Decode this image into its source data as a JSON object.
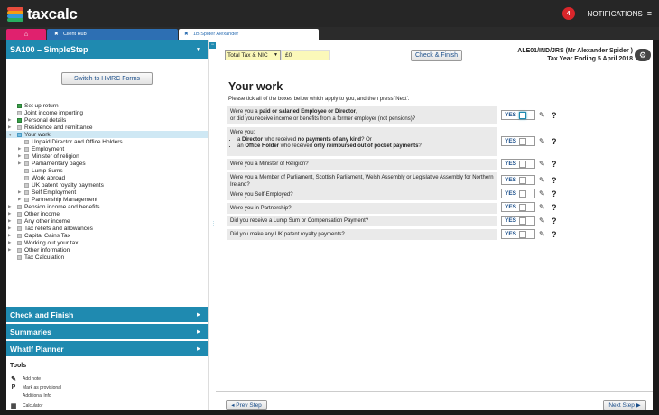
{
  "app": {
    "logo_text": "taxcalc",
    "logo_stripes": [
      "#e84c3d",
      "#f39c12",
      "#3498db",
      "#27ae60"
    ]
  },
  "notifications": {
    "count": "4",
    "label": "NOTIFICATIONS",
    "menu_icon": "≡"
  },
  "tabs": {
    "home_icon": "⌂",
    "client_hub": {
      "close": "✖",
      "label": "Client Hub"
    },
    "active": {
      "close": "✖",
      "label": "1B Spider Alexander"
    }
  },
  "sidebar": {
    "header": "SA100 – SimpleStep",
    "header_caret": "▼",
    "hmrc_button": "Switch to HMRC Forms",
    "tree": [
      {
        "label": "Set up return",
        "box": "chk",
        "indent": 0,
        "arrow": ""
      },
      {
        "label": "Joint income importing",
        "box": "grey",
        "indent": 0,
        "arrow": ""
      },
      {
        "label": "Personal details",
        "box": "chk",
        "indent": 0,
        "arrow": "▶"
      },
      {
        "label": "Residence and remittance",
        "box": "grey",
        "indent": 0,
        "arrow": "▶"
      },
      {
        "label": "Your work",
        "box": "blu",
        "indent": 0,
        "arrow": "▼",
        "selected": true
      },
      {
        "label": "Unpaid Director and Office Holders",
        "box": "grey",
        "indent": 1,
        "arrow": ""
      },
      {
        "label": "Employment",
        "box": "grey",
        "indent": 1,
        "arrow": "▶"
      },
      {
        "label": "Minister of religion",
        "box": "grey",
        "indent": 1,
        "arrow": "▶"
      },
      {
        "label": "Parliamentary pages",
        "box": "grey",
        "indent": 1,
        "arrow": "▶"
      },
      {
        "label": "Lump Sums",
        "box": "grey",
        "indent": 1,
        "arrow": ""
      },
      {
        "label": "Work abroad",
        "box": "grey",
        "indent": 1,
        "arrow": ""
      },
      {
        "label": "UK patent royalty payments",
        "box": "grey",
        "indent": 1,
        "arrow": ""
      },
      {
        "label": "Self Employment",
        "box": "grey",
        "indent": 1,
        "arrow": "▶"
      },
      {
        "label": "Partnership Management",
        "box": "grey",
        "indent": 1,
        "arrow": "▶"
      },
      {
        "label": "Pension income and benefits",
        "box": "grey",
        "indent": 0,
        "arrow": "▶"
      },
      {
        "label": "Other income",
        "box": "grey",
        "indent": 0,
        "arrow": "▶"
      },
      {
        "label": "Any other income",
        "box": "grey",
        "indent": 0,
        "arrow": "▶"
      },
      {
        "label": "Tax reliefs and allowances",
        "box": "grey",
        "indent": 0,
        "arrow": "▶"
      },
      {
        "label": "Capital Gains Tax",
        "box": "grey",
        "indent": 0,
        "arrow": "▶"
      },
      {
        "label": "Working out your tax",
        "box": "grey",
        "indent": 0,
        "arrow": "▶"
      },
      {
        "label": "Other information",
        "box": "grey",
        "indent": 0,
        "arrow": "▶"
      },
      {
        "label": "Tax Calculation",
        "box": "grey",
        "indent": 0,
        "arrow": ""
      }
    ],
    "sections": [
      {
        "label": "Check and Finish",
        "caret": "▶"
      },
      {
        "label": "Summaries",
        "caret": "▶"
      },
      {
        "label": "WhatIf Planner",
        "caret": "▶"
      }
    ],
    "tools_title": "Tools",
    "tools": [
      {
        "icon": "✎",
        "label": "Add note"
      },
      {
        "icon": "P",
        "label": "Mark as provisional"
      },
      {
        "icon": "",
        "label": "Additional Info"
      },
      {
        "icon": "▦",
        "label": "Calculator"
      }
    ]
  },
  "splitter": {
    "collapse": "−",
    "grip": "⋮"
  },
  "toolbar": {
    "select_value": "Total Tax & NIC",
    "select_caret": "▼",
    "amount": "£0",
    "check_finish": "Check & Finish",
    "client_line1": "ALE01/IND/JRS (Mr Alexander Spider )",
    "client_line2": "Tax Year Ending 5 April 2018",
    "gear": "⚙"
  },
  "main": {
    "title": "Your work",
    "intro": "Please tick all of the boxes below which apply to you, and then press 'Next'.",
    "yes_label": "YES",
    "edit_icon": "✎",
    "help_icon": "?",
    "q1_pre": "Were you a ",
    "q1_bold": "paid or salaried Employee or Director",
    "q1_post": ",",
    "q1_line2": "or did you receive income or benefits from a former employer (not pensions)?",
    "q2_intro": "Were you:",
    "q2_b1_pre": "a ",
    "q2_b1_bold1": "Director",
    "q2_b1_mid": " who received ",
    "q2_b1_bold2": "no payments of any kind",
    "q2_b1_post": "? Or",
    "q2_b2_pre": "an ",
    "q2_b2_bold1": "Office Holder",
    "q2_b2_mid": " who received ",
    "q2_b2_bold2": "only reimbursed out of pocket payments",
    "q2_b2_post": "?",
    "q3": "Were you a Minister of Religion?",
    "q4": "Were you a Member of Parliament, Scottish Parliament, Welsh Assembly or Legislative Assembly for Northern Ireland?",
    "q5": "Were you Self-Employed?",
    "q6": "Were you in Partnership?",
    "q7": "Did you receive a Lump Sum or Compensation Payment?",
    "q8": "Did you make any UK patent royalty payments?"
  },
  "footer": {
    "prev": "◂ Prev Step",
    "next": "Next Step ▶"
  }
}
